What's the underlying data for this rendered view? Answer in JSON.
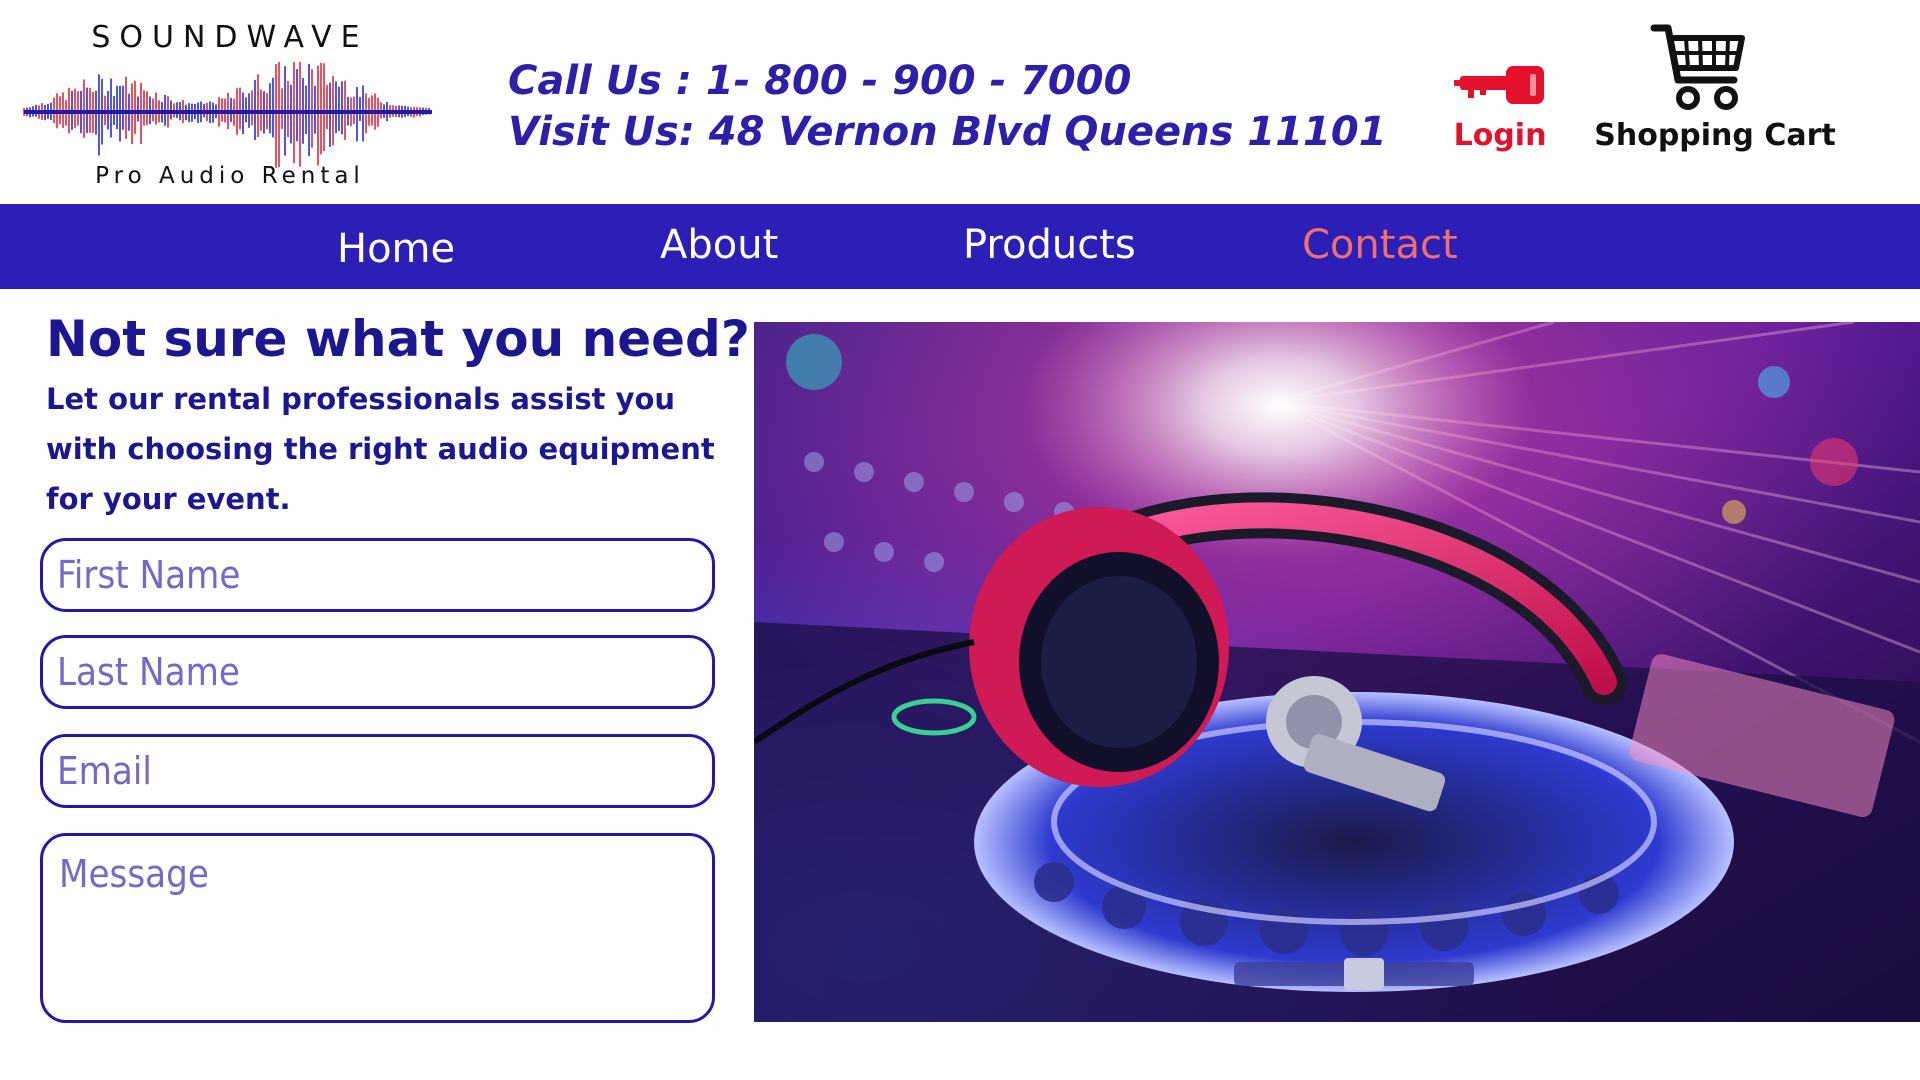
{
  "brand": {
    "name": "SOUNDWAVE",
    "tagline": "Pro Audio Rental"
  },
  "header": {
    "phone_line": "Call Us : 1- 800 - 900 - 7000",
    "address_line": "Visit Us: 48 Vernon Blvd  Queens 11101",
    "login_label": "Login",
    "cart_label": "Shopping Cart"
  },
  "nav": {
    "items": [
      {
        "label": "Home"
      },
      {
        "label": "About"
      },
      {
        "label": "Products"
      },
      {
        "label": "Contact"
      }
    ],
    "active": "Contact"
  },
  "main": {
    "heading": "Not sure what you need?",
    "subtext": "Let our rental professionals assist you with choosing the right audio equipment for your event.",
    "form": {
      "first_name_placeholder": "First Name",
      "last_name_placeholder": "Last Name",
      "email_placeholder": "Email",
      "message_placeholder": "Message"
    }
  },
  "colors": {
    "nav_background": "#2c1fb8",
    "primary_text": "#1c1790",
    "active_nav": "#ef6f6f",
    "login_red": "#e4102c"
  },
  "icons": {
    "login": "key-icon",
    "cart": "shopping-cart-icon"
  }
}
